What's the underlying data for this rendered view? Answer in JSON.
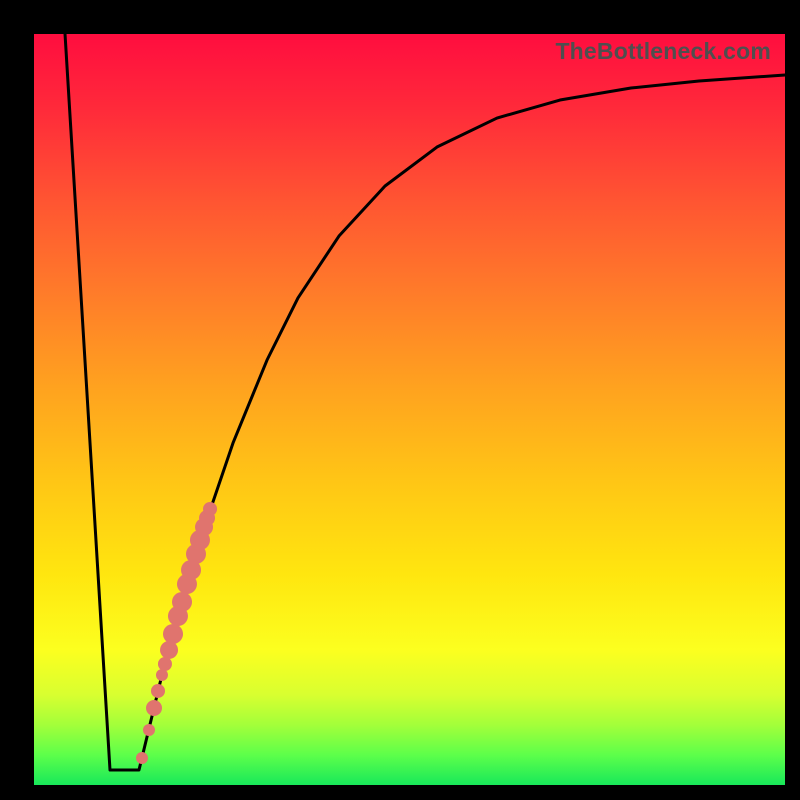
{
  "watermark": "TheBottleneck.com",
  "chart_data": {
    "type": "line",
    "title": "",
    "xlabel": "",
    "ylabel": "",
    "xlim": [
      0,
      100
    ],
    "ylim": [
      0,
      100
    ],
    "grid": false,
    "curve": [
      {
        "x": 4.13,
        "y": 100
      },
      {
        "x": 10.12,
        "y": 2.0
      },
      {
        "x": 13.98,
        "y": 2.0
      },
      {
        "x": 16.91,
        "y": 14.11
      },
      {
        "x": 19.97,
        "y": 25.3
      },
      {
        "x": 22.24,
        "y": 33.02
      },
      {
        "x": 26.5,
        "y": 45.54
      },
      {
        "x": 31.03,
        "y": 56.59
      },
      {
        "x": 35.15,
        "y": 64.85
      },
      {
        "x": 40.61,
        "y": 73.1
      },
      {
        "x": 46.74,
        "y": 79.76
      },
      {
        "x": 53.66,
        "y": 84.95
      },
      {
        "x": 61.65,
        "y": 88.81
      },
      {
        "x": 70.04,
        "y": 91.21
      },
      {
        "x": 79.49,
        "y": 92.81
      },
      {
        "x": 88.55,
        "y": 93.74
      },
      {
        "x": 100.0,
        "y": 94.54
      }
    ],
    "series": [
      {
        "name": "points",
        "type": "scatter",
        "marker": "circle",
        "color": "#e0746e",
        "values": [
          {
            "x": 14.38,
            "y": 3.6,
            "r": 6
          },
          {
            "x": 15.31,
            "y": 7.32,
            "r": 6
          },
          {
            "x": 15.98,
            "y": 10.25,
            "r": 8
          },
          {
            "x": 16.51,
            "y": 12.52,
            "r": 7
          },
          {
            "x": 17.04,
            "y": 14.65,
            "r": 6
          },
          {
            "x": 17.44,
            "y": 16.11,
            "r": 7
          },
          {
            "x": 17.98,
            "y": 17.98,
            "r": 9
          },
          {
            "x": 18.51,
            "y": 20.11,
            "r": 10
          },
          {
            "x": 19.17,
            "y": 22.5,
            "r": 10
          },
          {
            "x": 19.71,
            "y": 24.37,
            "r": 10
          },
          {
            "x": 20.37,
            "y": 26.76,
            "r": 10
          },
          {
            "x": 20.91,
            "y": 28.63,
            "r": 10
          },
          {
            "x": 21.57,
            "y": 30.76,
            "r": 10
          },
          {
            "x": 22.1,
            "y": 32.62,
            "r": 10
          },
          {
            "x": 22.64,
            "y": 34.35,
            "r": 9
          },
          {
            "x": 23.04,
            "y": 35.55,
            "r": 8
          },
          {
            "x": 23.44,
            "y": 36.75,
            "r": 7
          }
        ]
      }
    ]
  }
}
